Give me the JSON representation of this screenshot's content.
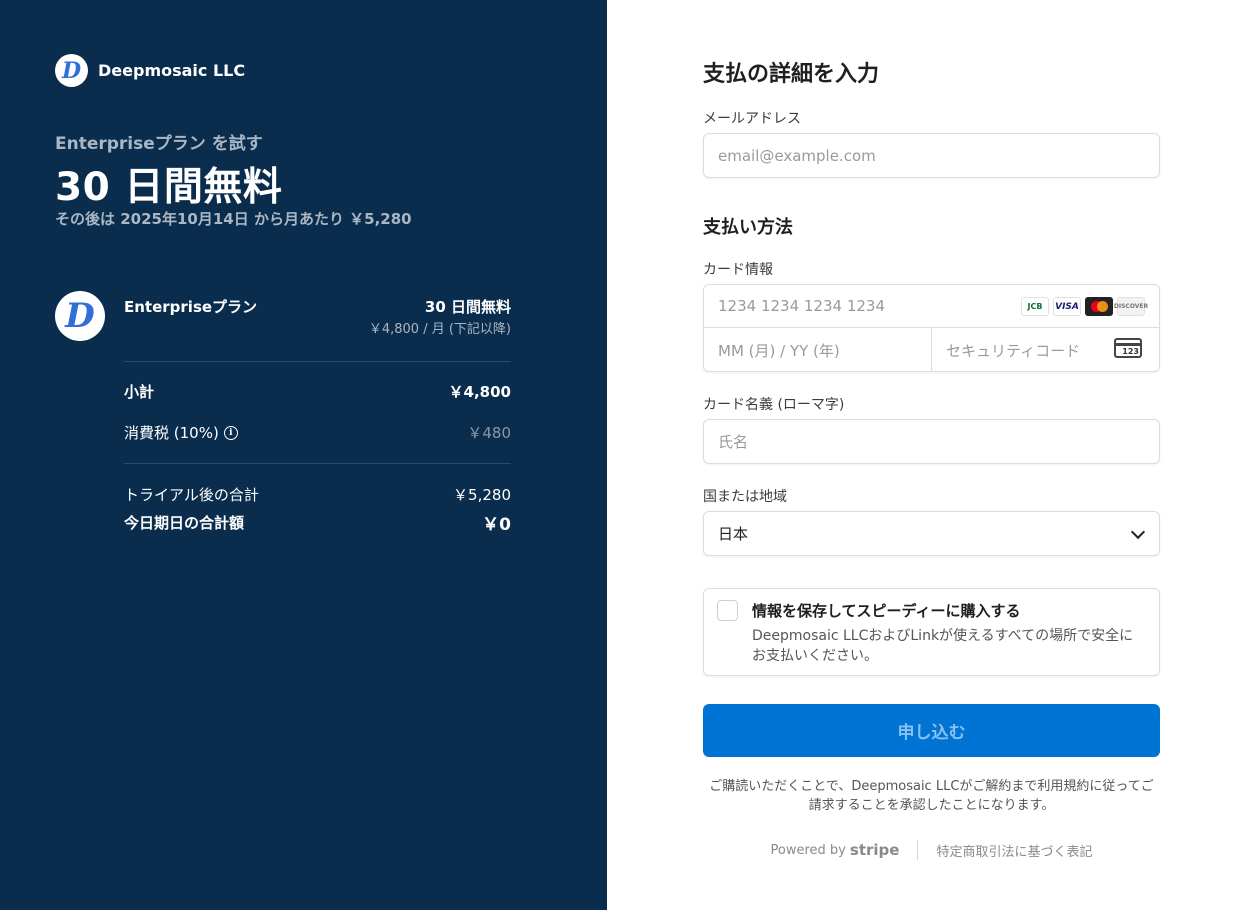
{
  "merchant": {
    "name": "Deepmosaic LLC",
    "logo_letter": "D"
  },
  "trial": {
    "subtitle": "Enterpriseプラン を試す",
    "headline": "30 日間無料",
    "note": "その後は 2025年10月14日 から月あたり ￥5,280"
  },
  "line_item": {
    "name": "Enterpriseプラン",
    "price": "30 日間無料",
    "price_sub": "￥4,800 / 月 (下記以降)"
  },
  "summary": {
    "subtotal_label": "小計",
    "subtotal_value": "￥4,800",
    "tax_label": "消費税 (10%)",
    "tax_value": "￥480",
    "after_trial_label": "トライアル後の合計",
    "after_trial_value": "￥5,280",
    "today_label": "今日期日の合計額",
    "today_value": "￥0"
  },
  "form": {
    "title": "支払の詳細を入力",
    "email_label": "メールアドレス",
    "email_placeholder": "email@example.com",
    "method_title": "支払い方法",
    "card_label": "カード情報",
    "card_number_placeholder": "1234 1234 1234 1234",
    "expiry_placeholder": "MM (月) / YY (年)",
    "cvc_placeholder": "セキュリティコード",
    "cvc_icon_text": "123",
    "card_brands": [
      "JCB",
      "VISA",
      "mastercard",
      "DISCOVER"
    ],
    "name_label": "カード名義 (ローマ字)",
    "name_placeholder": "氏名",
    "country_label": "国または地域",
    "country_value": "日本",
    "save_title": "情報を保存してスピーディーに購入する",
    "save_desc": "Deepmosaic LLCおよびLinkが使えるすべての場所で安全にお支払いください。",
    "submit_label": "申し込む",
    "terms": "ご購読いただくことで、Deepmosaic LLCがご解約まで利用規約に従ってご請求することを承認したことになります。",
    "powered_by": "Powered by",
    "stripe": "stripe",
    "legal_link": "特定商取引法に基づく表記"
  },
  "colors": {
    "left_bg": "#0b2d4d",
    "accent": "#0074d4",
    "logo_blue": "#2f6fd6"
  }
}
